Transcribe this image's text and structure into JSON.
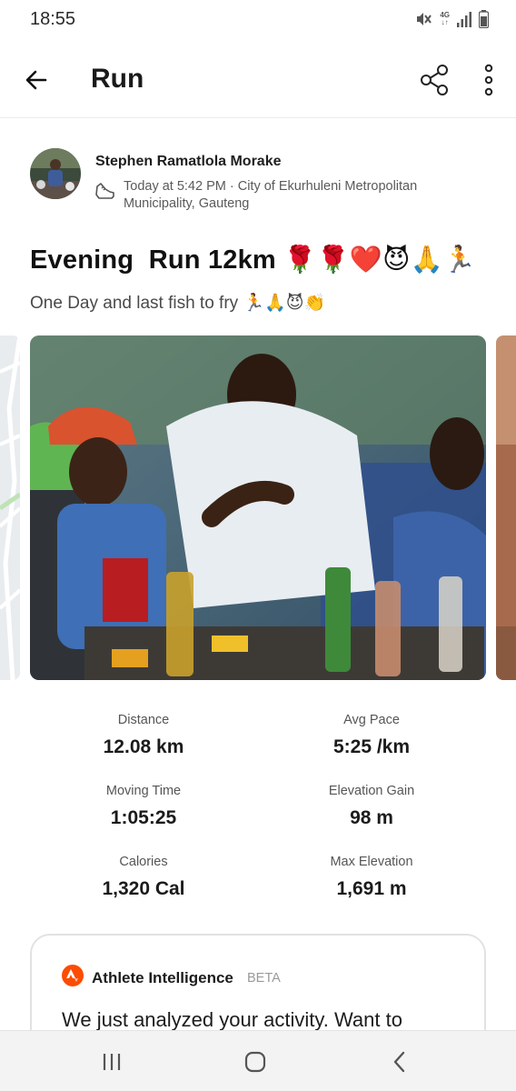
{
  "status_bar": {
    "time": "18:55",
    "network_label": "4G",
    "icons": [
      "mute-icon",
      "4g-data-icon",
      "signal-icon",
      "battery-icon"
    ]
  },
  "app_bar": {
    "title": "Run",
    "icons": [
      "back-arrow-icon",
      "share-icon",
      "more-vertical-icon"
    ]
  },
  "athlete": {
    "name": "Stephen Ramatlola Morake",
    "meta": "Today at 5:42 PM · City of Ekurhuleni Metropolitan Municipality, Gauteng"
  },
  "activity": {
    "title": "Evening  Run 12km 🌹🌹❤️😈🙏🏃",
    "description": "One Day and last fish to fry 🏃🙏😈👏"
  },
  "stats": [
    {
      "label": "Distance",
      "value": "12.08 km"
    },
    {
      "label": "Avg Pace",
      "value": "5:25 /km"
    },
    {
      "label": "Moving Time",
      "value": "1:05:25"
    },
    {
      "label": "Elevation Gain",
      "value": "98 m"
    },
    {
      "label": "Calories",
      "value": "1,320 Cal"
    },
    {
      "label": "Max Elevation",
      "value": "1,691 m"
    }
  ],
  "ai_card": {
    "title": "Athlete Intelligence",
    "badge": "BETA",
    "body": "We just analyzed your activity. Want to"
  },
  "colors": {
    "brand_orange": "#fc4c02",
    "text_primary": "#1c1c1c",
    "text_secondary": "#5a5a5a"
  },
  "nav_bar": {
    "icons": [
      "recent-apps-icon",
      "home-icon",
      "back-icon"
    ]
  }
}
